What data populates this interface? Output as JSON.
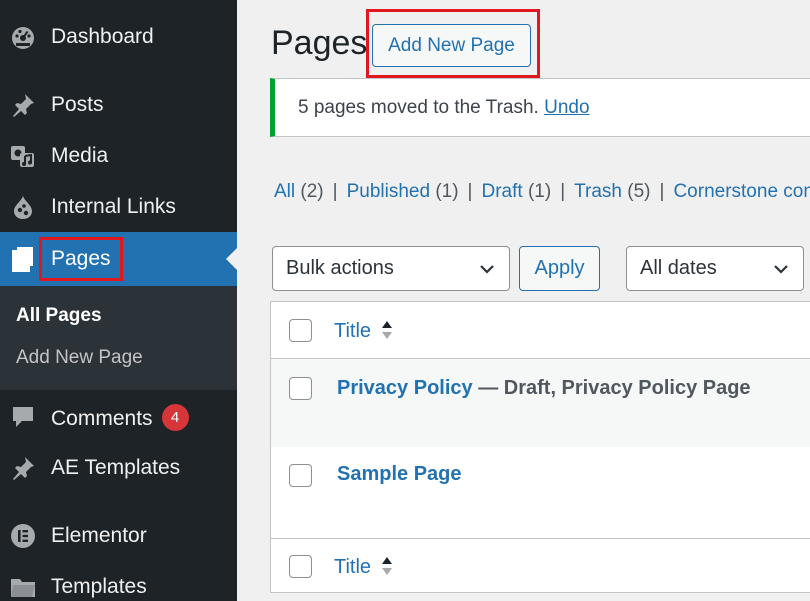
{
  "sidebar": {
    "items": [
      {
        "label": "Dashboard",
        "icon": "dashboard-icon"
      },
      {
        "label": "Posts",
        "icon": "pin-icon"
      },
      {
        "label": "Media",
        "icon": "media-icon"
      },
      {
        "label": "Internal Links",
        "icon": "internal-links-icon"
      },
      {
        "label": "Pages",
        "icon": "pages-icon"
      },
      {
        "label": "Comments",
        "icon": "comments-icon",
        "badge": "4"
      },
      {
        "label": "AE Templates",
        "icon": "pin-icon"
      },
      {
        "label": "Elementor",
        "icon": "elementor-icon"
      },
      {
        "label": "Templates",
        "icon": "folder-icon"
      }
    ],
    "submenu": [
      {
        "label": "All Pages"
      },
      {
        "label": "Add New Page"
      }
    ]
  },
  "main": {
    "title": "Pages",
    "add_new_label": "Add New Page",
    "notice": {
      "text": "5 pages moved to the Trash.",
      "undo": "Undo"
    },
    "filters": [
      {
        "label": "All",
        "count": "(2)"
      },
      {
        "label": "Published",
        "count": "(1)"
      },
      {
        "label": "Draft",
        "count": "(1)"
      },
      {
        "label": "Trash",
        "count": "(5)"
      },
      {
        "label": "Cornerstone con",
        "count": ""
      }
    ],
    "bulk_actions": "Bulk actions",
    "apply": "Apply",
    "all_dates": "All dates",
    "table": {
      "column_title": "Title",
      "rows": [
        {
          "title": "Privacy Policy",
          "state": " — Draft, Privacy Policy Page"
        },
        {
          "title": "Sample Page",
          "state": ""
        }
      ]
    }
  },
  "colors": {
    "sidebar_bg": "#1d2327",
    "accent": "#2271b1",
    "notice_success": "#00a32a",
    "badge": "#d63638",
    "highlight": "#e0171f"
  }
}
